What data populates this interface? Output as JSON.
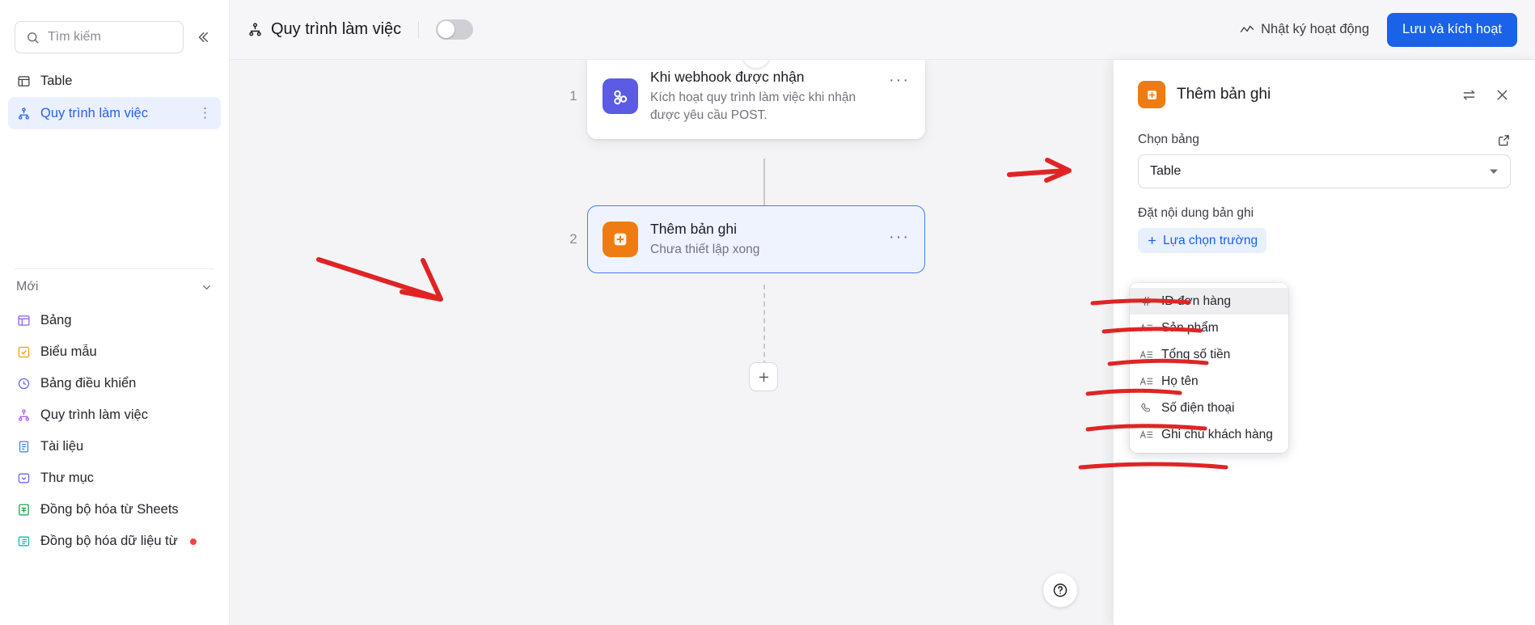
{
  "sidebar": {
    "search": {
      "placeholder": "Tìm kiếm",
      "icon": "search-icon"
    },
    "collapse_icon": "chevrons-left-icon",
    "items": [
      {
        "label": "Table",
        "icon": "table-icon",
        "active": false
      },
      {
        "label": "Quy trình làm việc",
        "icon": "workflow-icon",
        "active": true
      }
    ],
    "section": {
      "label": "Mới",
      "chevron": "chevron-down-icon"
    },
    "new_items": [
      {
        "label": "Bảng",
        "icon": "grid-icon",
        "color": "#8b5cf6"
      },
      {
        "label": "Biểu mẫu",
        "icon": "form-check-icon",
        "color": "#f59e0b"
      },
      {
        "label": "Bảng điều khiển",
        "icon": "dashboard-clock-icon",
        "color": "#6366f1"
      },
      {
        "label": "Quy trình làm việc",
        "icon": "workflow-icon",
        "color": "#a855f7"
      },
      {
        "label": "Tài liệu",
        "icon": "document-icon",
        "color": "#3b82f6"
      },
      {
        "label": "Thư mục",
        "icon": "folder-check-icon",
        "color": "#6366f1"
      },
      {
        "label": "Đồng bộ hóa từ Sheets",
        "icon": "google-sheets-icon",
        "color": "#16a34a"
      },
      {
        "label": "Đồng bộ hóa dữ liệu từ",
        "icon": "sync-data-icon",
        "color": "#14b8a6",
        "badge_dot": "#ef4444"
      }
    ]
  },
  "topbar": {
    "icon": "workflow-icon",
    "title": "Quy trình làm việc",
    "toggle_on": false,
    "activity_log": {
      "label": "Nhật ký hoạt động",
      "icon": "activity-line-icon"
    },
    "save_button": "Lưu và kích hoạt"
  },
  "canvas": {
    "nodes": [
      {
        "number": "1",
        "title": "Khi webhook được nhận",
        "subtitle": "Kích hoạt quy trình làm việc khi nhận được yêu cầu POST.",
        "icon": "webhook-icon",
        "icon_color": "#5b5be3",
        "badge": "bolt-icon",
        "selected": false,
        "menu": "···"
      },
      {
        "number": "2",
        "title": "Thêm bản ghi",
        "subtitle": "Chưa thiết lập xong",
        "icon": "add-record-icon",
        "icon_color": "#ef7c12",
        "selected": true,
        "menu": "···"
      }
    ],
    "add_node_icon": "plus-icon",
    "help_icon": "question-circle-icon"
  },
  "panel": {
    "icon": "add-record-icon",
    "title": "Thêm bản ghi",
    "swap_icon": "swap-arrows-icon",
    "close_icon": "close-icon",
    "table_field": {
      "label": "Chọn bảng",
      "expand_icon": "external-link-icon",
      "value": "Table",
      "caret": "chevron-down-icon"
    },
    "content_field": {
      "label": "Đặt nội dung bản ghi",
      "add_chip": "Lựa chọn trường",
      "add_chip_icon": "plus-icon"
    },
    "dropdown": {
      "items": [
        {
          "label": "ID đơn hàng",
          "icon": "hash-icon",
          "highlighted": true
        },
        {
          "label": "Sản phẩm",
          "icon": "text-field-icon",
          "highlighted": false
        },
        {
          "label": "Tổng số tiền",
          "icon": "text-field-icon",
          "highlighted": false
        },
        {
          "label": "Họ tên",
          "icon": "text-field-icon",
          "highlighted": false
        },
        {
          "label": "Số điện thoại",
          "icon": "phone-icon",
          "highlighted": false
        },
        {
          "label": "Ghi chú khách hàng",
          "icon": "text-field-icon",
          "highlighted": false
        }
      ]
    }
  },
  "annotations": {
    "color": "#e02424",
    "marks": [
      "arrow-to-table-select",
      "arrow-to-add-record-node",
      "underline-id-don-hang",
      "underline-san-pham",
      "underline-tong-so-tien",
      "underline-ho-ten",
      "underline-so-dien-thoai",
      "underline-ghi-chu-khach-hang"
    ]
  }
}
